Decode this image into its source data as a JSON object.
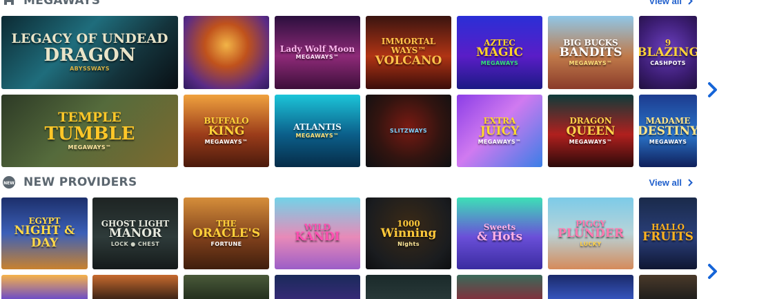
{
  "megaways": {
    "title": "MEGAWAYS",
    "view_all": "View all",
    "row1": [
      {
        "line1": "LEGACY OF UNDEAD",
        "line2": "DRAGON",
        "line3": "ABYSSWAYS",
        "bg": "linear-gradient(135deg,#0c2a33 0%,#1f6d7c 40%,#14333b 70%,#090f14 100%)",
        "fg": "#e9e4c8",
        "accent": "#d8b245"
      },
      {
        "line1": "",
        "line2": "",
        "line3": "",
        "bg": "radial-gradient(circle at 50% 40%,#f2b447 0%,#c0521c 35%,#5a2b86 75%,#2f1b5f 100%)",
        "fg": "#ffd25a",
        "accent": "#ffffff"
      },
      {
        "line1": "Lady Wolf Moon",
        "line2": "",
        "line3": "MEGAWAYS™",
        "bg": "linear-gradient(180deg,#2b0f3d 0%,#8e2a78 55%,#3d0f3a 100%)",
        "fg": "#ffb8ef",
        "accent": "#ffe0f7"
      },
      {
        "line1": "IMMORTAL WAYS™",
        "line2": "VOLCANO",
        "line3": "",
        "bg": "linear-gradient(180deg,#3a1410 0%,#b03414 55%,#3b0d0a 100%)",
        "fg": "#ffc24a",
        "accent": "#ffe7a8"
      },
      {
        "line1": "AZTEC",
        "line2": "MAGIC",
        "line3": "MEGAWAYS",
        "bg": "linear-gradient(180deg,#2a2fd6 0%,#5a1dc7 55%,#1b1a84 100%)",
        "fg": "#ffd32a",
        "accent": "#34e27a"
      },
      {
        "line1": "BIG BUCKS",
        "line2": "BANDITS",
        "line3": "MEGAWAYS™",
        "bg": "linear-gradient(180deg,#8fc7e8 0%,#c07a4a 55%,#8a3b2a 100%)",
        "fg": "#ffffff",
        "accent": "#ffdf7a"
      },
      {
        "line1": "9",
        "line2": "BLAZING",
        "line3": "CASHPOTS",
        "bg": "radial-gradient(circle at 50% 45%,#6b3fbf 0%,#3c1d73 60%,#21103f 100%)",
        "fg": "#ffd23a",
        "accent": "#ffffff"
      }
    ],
    "row2": [
      {
        "line1": "TEMPLE",
        "line2": "TUMBLE",
        "line3": "MEGAWAYS™",
        "bg": "linear-gradient(135deg,#2d3a26 0%,#556b3c 45%,#7d6a2e 100%)",
        "fg": "#ffc728",
        "accent": "#ffe7a2"
      },
      {
        "line1": "BUFFALO",
        "line2": "KING",
        "line3": "MEGAWAYS™",
        "bg": "linear-gradient(180deg,#f0a23e 0%,#9b3c1a 55%,#4a1a0c 100%)",
        "fg": "#ffd23a",
        "accent": "#ffffff"
      },
      {
        "line1": "ATLANTIS",
        "line2": "",
        "line3": "MEGAWAYS™",
        "bg": "linear-gradient(180deg,#1cc5d9 0%,#0b5f8a 55%,#062c48 100%)",
        "fg": "#e9f7ff",
        "accent": "#ffe27a"
      },
      {
        "line1": "",
        "line2": "",
        "line3": "SLITZWAYS",
        "bg": "radial-gradient(circle at 50% 45%,#7a1a12 0%,#321410 55%,#0e1012 100%)",
        "fg": "#ffc43a",
        "accent": "#7fd3ff"
      },
      {
        "line1": "EXTRA",
        "line2": "JUICY",
        "line3": "MEGAWAYS™",
        "bg": "linear-gradient(135deg,#8b3ee6 0%,#d07af0 45%,#3b7ee6 100%)",
        "fg": "#ffd82e",
        "accent": "#ffffff"
      },
      {
        "line1": "DRAGON",
        "line2": "QUEEN",
        "line3": "MEGAWAYS™",
        "bg": "linear-gradient(180deg,#0f3b3a 0%,#b0201e 55%,#2b0a0a 100%)",
        "fg": "#ffd24a",
        "accent": "#ffffff"
      },
      {
        "line1": "MADAME",
        "line2": "DESTINY",
        "line3": "MEGAWAYS",
        "bg": "linear-gradient(180deg,#1d3c8f 0%,#2a74c9 55%,#0f1f5a 100%)",
        "fg": "#ffe58a",
        "accent": "#ffffff"
      }
    ]
  },
  "new_providers": {
    "title": "NEW PROVIDERS",
    "view_all": "View all",
    "row1": [
      {
        "line1": "EGYPT",
        "line2": "NIGHT & DAY",
        "line3": "",
        "bg": "linear-gradient(180deg,#1c2f6b 0%,#3c60b8 50%,#c9822e 100%)",
        "fg": "#ffd94a",
        "accent": "#ffffff"
      },
      {
        "line1": "GHOST LIGHT",
        "line2": "MANOR",
        "line3": "LOCK ● CHEST",
        "bg": "linear-gradient(180deg,#1e2423 0%,#2e3b3a 55%,#151a1a 100%)",
        "fg": "#e8eadf",
        "accent": "#cfd3c5"
      },
      {
        "line1": "THE",
        "line2": "ORACLE'S",
        "line3": "FORTUNE",
        "bg": "linear-gradient(180deg,#d68e3a 0%,#7a3d1a 60%,#3f1e0d 100%)",
        "fg": "#ffcf3a",
        "accent": "#ffffff"
      },
      {
        "line1": "WILD",
        "line2": "KANDI",
        "line3": "",
        "bg": "linear-gradient(180deg,#72d3e8 0%,#e88ab8 55%,#9c5ec7 100%)",
        "fg": "#ff4fb2",
        "accent": "#ffe13a"
      },
      {
        "line1": "1000",
        "line2": "Winning",
        "line3": "Nights",
        "bg": "radial-gradient(circle at 50% 40%,#3b2a16 0%,#1a1c1f 70%,#0d0e10 100%)",
        "fg": "#ffc93a",
        "accent": "#ffe89a"
      },
      {
        "line1": "Sweets",
        "line2": "& Hots",
        "line3": "",
        "bg": "linear-gradient(180deg,#3de0b6 0%,#6a4fd8 55%,#3a2ba0 100%)",
        "fg": "#ffb0e6",
        "accent": "#ffffff"
      },
      {
        "line1": "PIGGY",
        "line2": "PLUNDER",
        "line3": "LUCKY",
        "bg": "linear-gradient(180deg,#7ccbe8 0%,#b8d3d8 50%,#d58a5a 100%)",
        "fg": "#ff7ab0",
        "accent": "#ffd24a"
      },
      {
        "line1": "HALLO",
        "line2": "FRUITS",
        "line3": "",
        "bg": "linear-gradient(180deg,#1a2a4a 0%,#2a3f7a 55%,#0f1632 100%)",
        "fg": "#ffb21f",
        "accent": "#ffffff"
      }
    ],
    "row2": [
      {
        "bg": "linear-gradient(180deg,#f6b24a 0%,#5a3fd8 100%)"
      },
      {
        "bg": "linear-gradient(180deg,#c76a2e 0%,#2a1a12 100%)"
      },
      {
        "bg": "linear-gradient(180deg,#4a5a3a 0%,#1f2a1a 100%)"
      },
      {
        "bg": "linear-gradient(180deg,#1a2a5a 0%,#3a2a7a 100%)"
      },
      {
        "bg": "linear-gradient(180deg,#1a2a2a 0%,#2a3a3a 100%)"
      },
      {
        "bg": "linear-gradient(180deg,#3a6a5a 0%,#8a2a3a 100%)"
      },
      {
        "bg": "linear-gradient(180deg,#1a2a6a 0%,#3a5ac8 100%)"
      },
      {
        "bg": "linear-gradient(180deg,#4a3a2a 0%,#1a1a1a 100%)"
      }
    ]
  },
  "icons": {
    "megaways": "megaways-icon",
    "new_providers": "new-badge-icon",
    "view_all": "chevron-right-icon",
    "next": "chevron-right-icon"
  },
  "colors": {
    "link": "#1f5fcc",
    "heading": "#5c6770",
    "arrow": "#1665d8"
  }
}
